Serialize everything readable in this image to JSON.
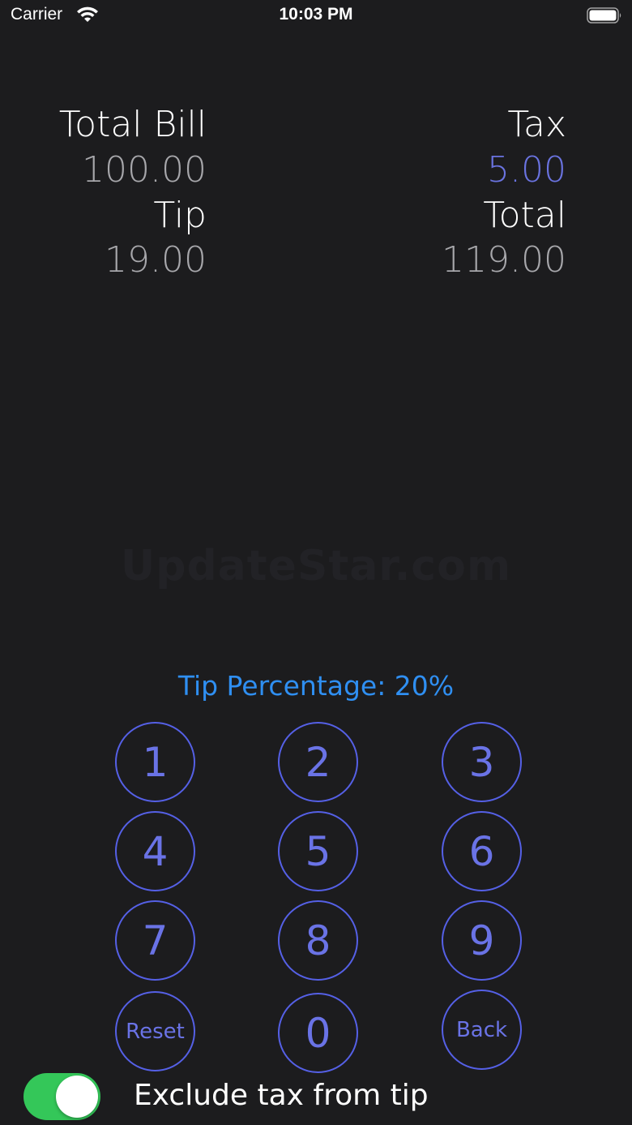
{
  "status_bar": {
    "carrier": "Carrier",
    "time": "10:03 PM"
  },
  "summary": {
    "total_bill_label": "Total Bill",
    "total_bill_value": "100.00",
    "tax_label": "Tax",
    "tax_value": "5.00",
    "tip_label": "Tip",
    "tip_value": "19.00",
    "total_label": "Total",
    "total_value": "119.00"
  },
  "watermark": "UpdateStar.com",
  "tip_percentage": "Tip Percentage: 20%",
  "keypad": {
    "k1": "1",
    "k2": "2",
    "k3": "3",
    "k4": "4",
    "k5": "5",
    "k6": "6",
    "k7": "7",
    "k8": "8",
    "k9": "9",
    "reset": "Reset",
    "k0": "0",
    "back": "Back"
  },
  "exclude_tax": {
    "label": "Exclude tax from tip",
    "enabled": true
  },
  "colors": {
    "background": "#1c1c1e",
    "accent_key": "#5560e6",
    "tip_percentage": "#2f8ff2",
    "tax_value": "#6a73e0",
    "toggle_on": "#34c759"
  },
  "icons": [
    "wifi-icon",
    "battery-icon"
  ]
}
